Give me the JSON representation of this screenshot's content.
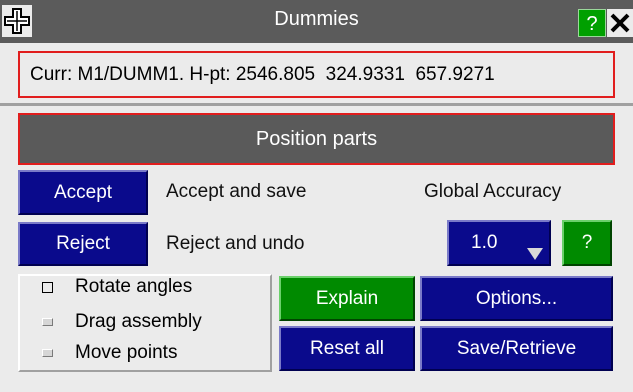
{
  "window": {
    "title": "Dummies",
    "help_label": "?",
    "move_icon": "move-cross-icon",
    "close_icon": "close-x-icon"
  },
  "current": {
    "text": "Curr: M1/DUMM1. H-pt: 2546.805  324.9331  657.9271"
  },
  "position_button": "Position parts",
  "actions": {
    "accept_label": "Accept",
    "accept_desc": "Accept and save",
    "reject_label": "Reject",
    "reject_desc": "Reject and undo",
    "global_accuracy_label": "Global Accuracy",
    "accuracy_value": "1.0",
    "accuracy_help": "?"
  },
  "modes": [
    {
      "label": "Rotate angles",
      "selected": true
    },
    {
      "label": "Drag assembly",
      "selected": false
    },
    {
      "label": "Move points",
      "selected": false
    }
  ],
  "buttons": {
    "explain": "Explain",
    "options": "Options...",
    "reset_all": "Reset all",
    "save_retrieve": "Save/Retrieve"
  },
  "colors": {
    "title_bar": "#5b5b5b",
    "highlight_border": "#e11d1d",
    "button_blue": "#0a0a8c",
    "button_green": "#008a00"
  }
}
